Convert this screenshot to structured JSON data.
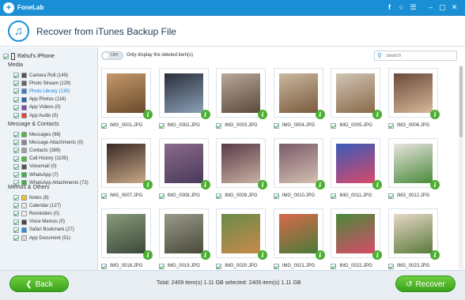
{
  "app": {
    "name": "FoneLab",
    "logo_icon": "fonelab-plus-icon"
  },
  "titlebar_icons": [
    "facebook-icon",
    "chat-icon",
    "menu-icon",
    "minimize-icon",
    "restore-icon",
    "close-icon"
  ],
  "header": {
    "title": "Recover from iTunes Backup File",
    "icon": "music-note-icon"
  },
  "sidebar": {
    "device": "Rahul's iPhone",
    "sections": [
      {
        "title": "Media",
        "items": [
          {
            "label": "Camera Roll (149)",
            "icon": "camera-icon",
            "color": "#555555"
          },
          {
            "label": "Photo Stream (129)",
            "icon": "photo-stream-icon",
            "color": "#666666"
          },
          {
            "label": "Photo Library (130)",
            "icon": "photo-library-icon",
            "color": "#3a7fcc",
            "selected": true
          },
          {
            "label": "App Photos (116)",
            "icon": "app-photos-icon",
            "color": "#2a67b1"
          },
          {
            "label": "App Videos (0)",
            "icon": "app-videos-icon",
            "color": "#7a4db8"
          },
          {
            "label": "App Audio (0)",
            "icon": "app-audio-icon",
            "color": "#e0482f"
          }
        ]
      },
      {
        "title": "Message & Contacts",
        "items": [
          {
            "label": "Messages (98)",
            "icon": "messages-icon",
            "color": "#4cba3a"
          },
          {
            "label": "Message Attachments (0)",
            "icon": "attachment-icon",
            "color": "#888888"
          },
          {
            "label": "Contacts (389)",
            "icon": "contacts-icon",
            "color": "#a0a0a0"
          },
          {
            "label": "Call History (1105)",
            "icon": "phone-icon",
            "color": "#4cba3a"
          },
          {
            "label": "Voicemail (0)",
            "icon": "voicemail-icon",
            "color": "#555555"
          },
          {
            "label": "WhatsApp (7)",
            "icon": "whatsapp-icon",
            "color": "#3cb44a"
          },
          {
            "label": "WhatsApp Attachments (73)",
            "icon": "whatsapp-attachments-icon",
            "color": "#3cb44a"
          }
        ]
      },
      {
        "title": "Memos & Others",
        "items": [
          {
            "label": "Notes (8)",
            "icon": "notes-icon",
            "color": "#f2c12e"
          },
          {
            "label": "Calendar (127)",
            "icon": "calendar-icon",
            "color": "#e8e8e8"
          },
          {
            "label": "Reminders (0)",
            "icon": "reminders-icon",
            "color": "#f0f0f0"
          },
          {
            "label": "Voice Memos (0)",
            "icon": "voice-memos-icon",
            "color": "#444444"
          },
          {
            "label": "Safari Bookmark (27)",
            "icon": "safari-icon",
            "color": "#2f8ee0"
          },
          {
            "label": "App Document (51)",
            "icon": "app-document-icon",
            "color": "#d8d8d8"
          }
        ]
      }
    ]
  },
  "toolbar": {
    "toggle_state": "OFF",
    "toggle_text": "Only display the deleted item(s)",
    "search_placeholder": "Search"
  },
  "photos": [
    {
      "name": "IMG_0001.JPG",
      "colors": [
        "#c49a6c",
        "#6b4a2a"
      ]
    },
    {
      "name": "IMG_0002.JPG",
      "colors": [
        "#2a2f3a",
        "#8aa0b8"
      ]
    },
    {
      "name": "IMG_0003.JPG",
      "colors": [
        "#b8a89a",
        "#5a4a3a"
      ]
    },
    {
      "name": "IMG_0004.JPG",
      "colors": [
        "#c9b8a0",
        "#7a5a3c"
      ]
    },
    {
      "name": "IMG_0005.JPG",
      "colors": [
        "#d0c4b4",
        "#8a6a48"
      ]
    },
    {
      "name": "IMG_0006.JPG",
      "colors": [
        "#6a4a3a",
        "#d8b898"
      ]
    },
    {
      "name": "IMG_0007.JPG",
      "colors": [
        "#3a2a24",
        "#c8a888"
      ]
    },
    {
      "name": "IMG_0008.JPG",
      "colors": [
        "#8a6a8a",
        "#4a3a5a"
      ]
    },
    {
      "name": "IMG_0009.JPG",
      "colors": [
        "#5a3a4a",
        "#c8b0a0"
      ]
    },
    {
      "name": "IMG_0010.JPG",
      "colors": [
        "#7a5a6a",
        "#d4c0b0"
      ]
    },
    {
      "name": "IMG_0011.JPG",
      "colors": [
        "#3a5ab8",
        "#d84a6a"
      ]
    },
    {
      "name": "IMG_0012.JPG",
      "colors": [
        "#e8e4e0",
        "#4a8a3a"
      ]
    },
    {
      "name": "IMG_0018.JPG",
      "colors": [
        "#8a9a7a",
        "#3a4a3a"
      ]
    },
    {
      "name": "IMG_0019.JPG",
      "colors": [
        "#9a9a8a",
        "#4a4a3a"
      ]
    },
    {
      "name": "IMG_0020.JPG",
      "colors": [
        "#6a8a4a",
        "#c88a4a"
      ]
    },
    {
      "name": "IMG_0021.JPG",
      "colors": [
        "#d86a4a",
        "#4a7a3a"
      ]
    },
    {
      "name": "IMG_0022.JPG",
      "colors": [
        "#4a8a3a",
        "#d84a6a"
      ]
    },
    {
      "name": "IMG_0023.JPG",
      "colors": [
        "#e8d8c8",
        "#5a7a3a"
      ]
    }
  ],
  "footer": {
    "back_label": "Back",
    "recover_label": "Recover",
    "status": "Total: 2409 item(s) 1.11 GB   selected: 2409 item(s) 1.11 GB"
  }
}
